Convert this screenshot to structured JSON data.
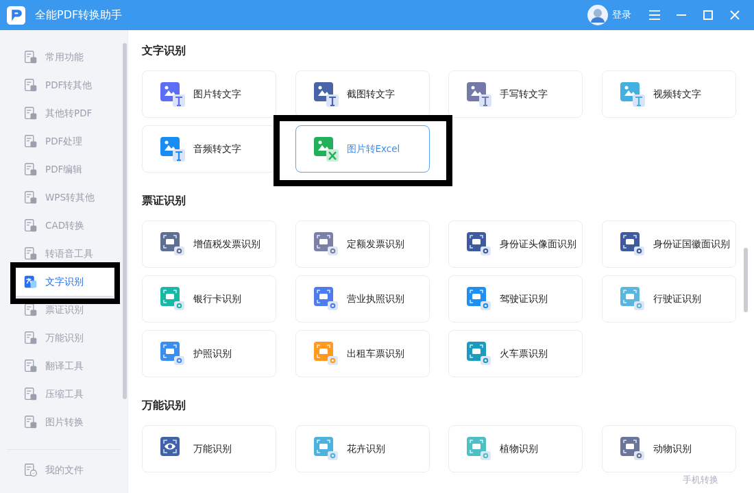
{
  "window": {
    "title": "全能PDF转换助手",
    "login": "登录"
  },
  "sidebar": {
    "items": [
      {
        "label": "常用功能",
        "selected": false,
        "highlighted": false
      },
      {
        "label": "PDF转其他",
        "selected": false,
        "highlighted": false
      },
      {
        "label": "其他转PDF",
        "selected": false,
        "highlighted": false
      },
      {
        "label": "PDF处理",
        "selected": false,
        "highlighted": false
      },
      {
        "label": "PDF编辑",
        "selected": false,
        "highlighted": false
      },
      {
        "label": "WPS转其他",
        "selected": false,
        "highlighted": false
      },
      {
        "label": "CAD转换",
        "selected": false,
        "highlighted": false
      },
      {
        "label": "转语音工具",
        "selected": false,
        "highlighted": false
      },
      {
        "label": "文字识别",
        "selected": true,
        "highlighted": true
      },
      {
        "label": "票证识别",
        "selected": false,
        "highlighted": false
      },
      {
        "label": "万能识别",
        "selected": false,
        "highlighted": false
      },
      {
        "label": "翻译工具",
        "selected": false,
        "highlighted": false
      },
      {
        "label": "压缩工具",
        "selected": false,
        "highlighted": false
      },
      {
        "label": "图片转换",
        "selected": false,
        "highlighted": false
      }
    ],
    "footer": {
      "label": "我的文件"
    }
  },
  "sections": [
    {
      "title": "文字识别",
      "cards": [
        {
          "label": "图片转文字",
          "kind": "text",
          "color": "#5b6ef5",
          "selected": false,
          "highlighted": false
        },
        {
          "label": "截图转文字",
          "kind": "text",
          "color": "#4a64a8",
          "selected": false,
          "highlighted": false
        },
        {
          "label": "手写转文字",
          "kind": "text",
          "color": "#7479a8",
          "selected": false,
          "highlighted": false
        },
        {
          "label": "视频转文字",
          "kind": "text",
          "color": "#43b0e0",
          "selected": false,
          "highlighted": false
        },
        {
          "label": "音频转文字",
          "kind": "text",
          "color": "#1a8df5",
          "selected": false,
          "highlighted": false
        },
        {
          "label": "图片转Excel",
          "kind": "excel",
          "color": "#22b05a",
          "selected": true,
          "highlighted": true
        }
      ]
    },
    {
      "title": "票证识别",
      "cards": [
        {
          "label": "增值税发票识别",
          "kind": "scan",
          "color": "#5e6f94",
          "selected": false,
          "highlighted": false
        },
        {
          "label": "定额发票识别",
          "kind": "scan",
          "color": "#7b80a8",
          "selected": false,
          "highlighted": false
        },
        {
          "label": "身份证头像面识别",
          "kind": "scan",
          "color": "#3e5b9f",
          "selected": false,
          "highlighted": false
        },
        {
          "label": "身份证国徽面识别",
          "kind": "scan",
          "color": "#3e5b9f",
          "selected": false,
          "highlighted": false
        },
        {
          "label": "银行卡识别",
          "kind": "scan",
          "color": "#17b8a6",
          "selected": false,
          "highlighted": false
        },
        {
          "label": "营业执照识别",
          "kind": "scan",
          "color": "#4c7cf0",
          "selected": false,
          "highlighted": false
        },
        {
          "label": "驾驶证识别",
          "kind": "scan",
          "color": "#1e8ff5",
          "selected": false,
          "highlighted": false
        },
        {
          "label": "行驶证识别",
          "kind": "scan",
          "color": "#5ab6dd",
          "selected": false,
          "highlighted": false
        },
        {
          "label": "护照识别",
          "kind": "scan",
          "color": "#3a8ef2",
          "selected": false,
          "highlighted": false
        },
        {
          "label": "出租车票识别",
          "kind": "scan",
          "color": "#ff9a1f",
          "selected": false,
          "highlighted": false
        },
        {
          "label": "火车票识别",
          "kind": "scan",
          "color": "#1b9bbd",
          "selected": false,
          "highlighted": false
        }
      ]
    },
    {
      "title": "万能识别",
      "cards": [
        {
          "label": "万能识别",
          "kind": "plain",
          "color": "#3f62a8",
          "selected": false,
          "highlighted": false
        },
        {
          "label": "花卉识别",
          "kind": "scan",
          "color": "#4cb3e0",
          "selected": false,
          "highlighted": false
        },
        {
          "label": "植物识别",
          "kind": "scan",
          "color": "#4cc0c4",
          "selected": false,
          "highlighted": false
        },
        {
          "label": "动物识别",
          "kind": "scan",
          "color": "#6a7599",
          "selected": false,
          "highlighted": false
        }
      ]
    }
  ],
  "floating_link": "手机转换"
}
